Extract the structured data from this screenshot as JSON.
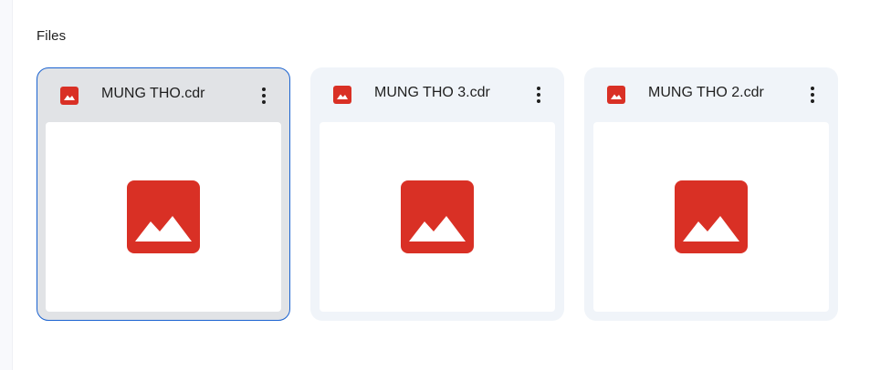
{
  "section": {
    "title": "Files"
  },
  "files": [
    {
      "name": "MUNG THO.cdr",
      "icon": "image-file-icon",
      "selected": true
    },
    {
      "name": "MUNG THO 3.cdr",
      "icon": "image-file-icon",
      "selected": false
    },
    {
      "name": "MUNG THO 2.cdr",
      "icon": "image-file-icon",
      "selected": false
    }
  ],
  "colors": {
    "accent": "#1a62d0",
    "image_icon": "#d93025",
    "card_bg": "#f0f4f9",
    "selected_card_bg": "#e1e3e6"
  }
}
